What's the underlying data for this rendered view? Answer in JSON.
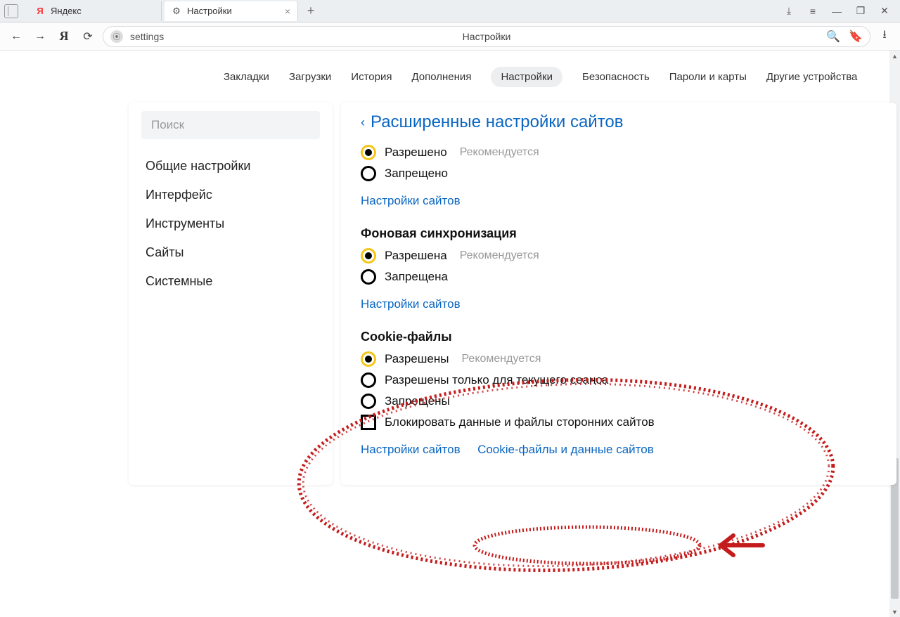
{
  "tabs": {
    "yandex": "Яндекс",
    "settings": "Настройки"
  },
  "addr": {
    "url": "settings",
    "center": "Настройки"
  },
  "nav": {
    "bookmarks": "Закладки",
    "downloads": "Загрузки",
    "history": "История",
    "addons": "Дополнения",
    "settings": "Настройки",
    "security": "Безопасность",
    "passwords": "Пароли и карты",
    "devices": "Другие устройства"
  },
  "sidebar": {
    "search_placeholder": "Поиск",
    "items": [
      "Общие настройки",
      "Интерфейс",
      "Инструменты",
      "Сайты",
      "Системные"
    ]
  },
  "main": {
    "title": "Расширенные настройки сайтов",
    "site_settings_link": "Настройки сайтов",
    "cookie_data_link": "Cookie-файлы и данные сайтов",
    "recommended": "Рекомендуется",
    "sec1": {
      "opt_allowed": "Разрешено",
      "opt_forbidden": "Запрещено"
    },
    "sec2": {
      "title": "Фоновая синхронизация",
      "opt_allowed": "Разрешена",
      "opt_forbidden": "Запрещена"
    },
    "sec3": {
      "title": "Cookie-файлы",
      "opt_allowed": "Разрешены",
      "opt_session": "Разрешены только для текущего сеанса",
      "opt_forbidden": "Запрещены",
      "opt_block3p": "Блокировать данные и файлы сторонних сайтов"
    }
  }
}
